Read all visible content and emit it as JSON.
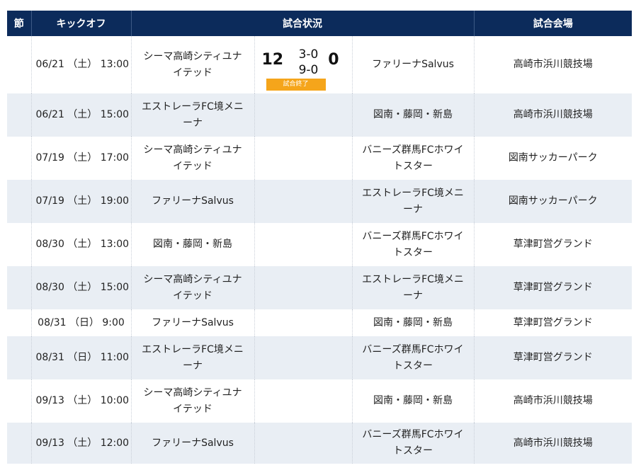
{
  "headers": {
    "round": "節",
    "kickoff": "キックオフ",
    "status": "試合状況",
    "venue": "試合会場"
  },
  "matches": [
    {
      "round": "",
      "kickoff": "06/21 （土） 13:00",
      "home": "シーマ高崎シティユナイテッド",
      "away": "ファリーナSalvus",
      "venue": "高崎市浜川競技場",
      "score": {
        "home": "12",
        "away": "0",
        "first_half": "3-0",
        "second_half": "9-0",
        "status": "試合終了"
      }
    },
    {
      "round": "",
      "kickoff": "06/21 （土） 15:00",
      "home": "エストレーラFC境メニーナ",
      "away": "図南・藤岡・新島",
      "venue": "高崎市浜川競技場"
    },
    {
      "round": "",
      "kickoff": "07/19 （土） 17:00",
      "home": "シーマ高崎シティユナイテッド",
      "away": "バニーズ群馬FCホワイトスター",
      "venue": "図南サッカーパーク"
    },
    {
      "round": "",
      "kickoff": "07/19 （土） 19:00",
      "home": "ファリーナSalvus",
      "away": "エストレーラFC境メニーナ",
      "venue": "図南サッカーパーク"
    },
    {
      "round": "",
      "kickoff": "08/30 （土） 13:00",
      "home": "図南・藤岡・新島",
      "away": "バニーズ群馬FCホワイトスター",
      "venue": "草津町営グランド"
    },
    {
      "round": "",
      "kickoff": "08/30 （土） 15:00",
      "home": "シーマ高崎シティユナイテッド",
      "away": "エストレーラFC境メニーナ",
      "venue": "草津町営グランド"
    },
    {
      "round": "",
      "kickoff": "08/31 （日） 9:00",
      "home": "ファリーナSalvus",
      "away": "図南・藤岡・新島",
      "venue": "草津町営グランド"
    },
    {
      "round": "",
      "kickoff": "08/31 （日） 11:00",
      "home": "エストレーラFC境メニーナ",
      "away": "バニーズ群馬FCホワイトスター",
      "venue": "草津町営グランド"
    },
    {
      "round": "",
      "kickoff": "09/13 （土） 10:00",
      "home": "シーマ高崎シティユナイテッド",
      "away": "図南・藤岡・新島",
      "venue": "高崎市浜川競技場"
    },
    {
      "round": "",
      "kickoff": "09/13 （土） 12:00",
      "home": "ファリーナSalvus",
      "away": "バニーズ群馬FCホワイトスター",
      "venue": "高崎市浜川競技場"
    }
  ]
}
